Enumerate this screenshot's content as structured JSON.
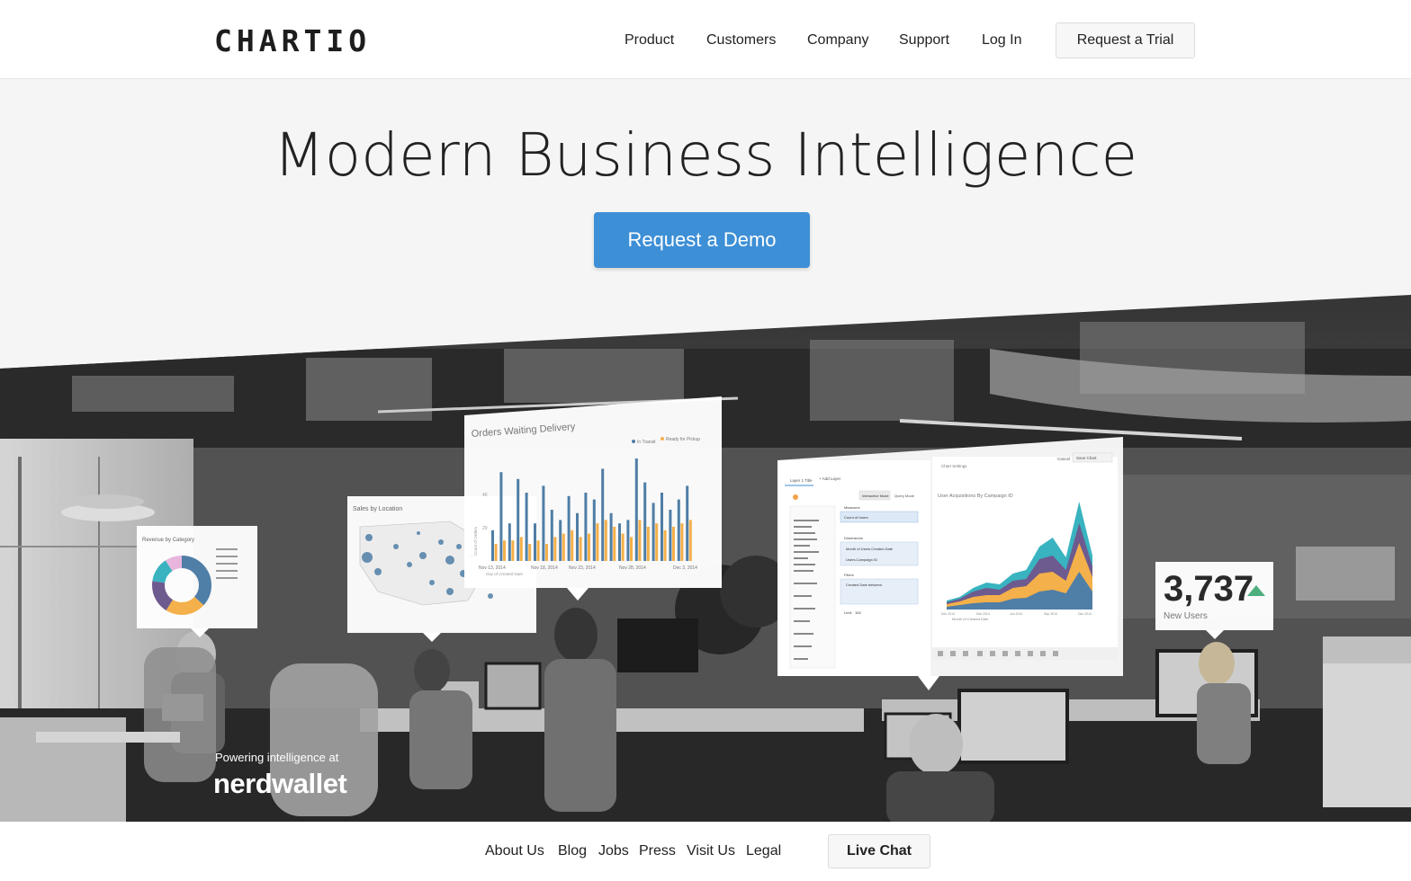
{
  "header": {
    "logo": "CHARTIO",
    "nav": [
      "Product",
      "Customers",
      "Company",
      "Support",
      "Log In"
    ],
    "trial_button": "Request a Trial"
  },
  "hero": {
    "title": "Modern Business Intelligence",
    "demo_button": "Request a Demo",
    "powering_label": "Powering intelligence at",
    "customer_logo": "nerdwallet"
  },
  "cards": {
    "revenue": {
      "title": "Revenue by Category"
    },
    "sales": {
      "title": "Sales by Location"
    },
    "orders": {
      "title": "Orders Waiting Delivery",
      "legend": [
        "In Transit",
        "Ready for Pickup"
      ],
      "ylabel": "Count of Orders",
      "xlabel": "Day of Created Date",
      "yticks": [
        "40",
        "20"
      ],
      "xticks": [
        "Nov 13, 2014",
        "Nov 18, 2014",
        "Nov 23, 2014",
        "Nov 28, 2014",
        "Dec 3, 2014"
      ]
    },
    "builder": {
      "tab_layer": "Layer 1 Title",
      "tab_add": "+ Add Layer",
      "chart_settings": "Chart Settings",
      "cancel": "Cancel",
      "save": "Save Chart",
      "mode_interactive": "Interactive Mode",
      "mode_query": "Query Mode",
      "measures_label": "Measures",
      "measure_value": "Count of Users",
      "dimensions_label": "Dimensions",
      "dimension_values": [
        "Month of Users.Created Date",
        "Users.Campaign ID"
      ],
      "filters_label": "Filters",
      "filter_value": "Created Date between",
      "limit_label": "Limit",
      "limit_value": "100",
      "chart_title": "User Acquisitions By Campaign ID",
      "xlabel": "Month of Created Date",
      "xticks": [
        "Dec 2013",
        "Mar 2014",
        "Jun 2014",
        "Sep 2014",
        "Dec 2014"
      ]
    },
    "new_users": {
      "value": "3,737",
      "label": "New Users"
    }
  },
  "footer": {
    "links": [
      "About Us",
      "Blog",
      "Jobs",
      "Press",
      "Visit Us",
      "Legal"
    ],
    "chat_button": "Live Chat"
  },
  "colors": {
    "accent": "#3d8fd6",
    "series_blue": "#4f7ea6",
    "series_orange": "#f4b04a",
    "series_purple": "#6d5a8e",
    "series_teal": "#39b3c0",
    "trend_up": "#4caf7d"
  }
}
